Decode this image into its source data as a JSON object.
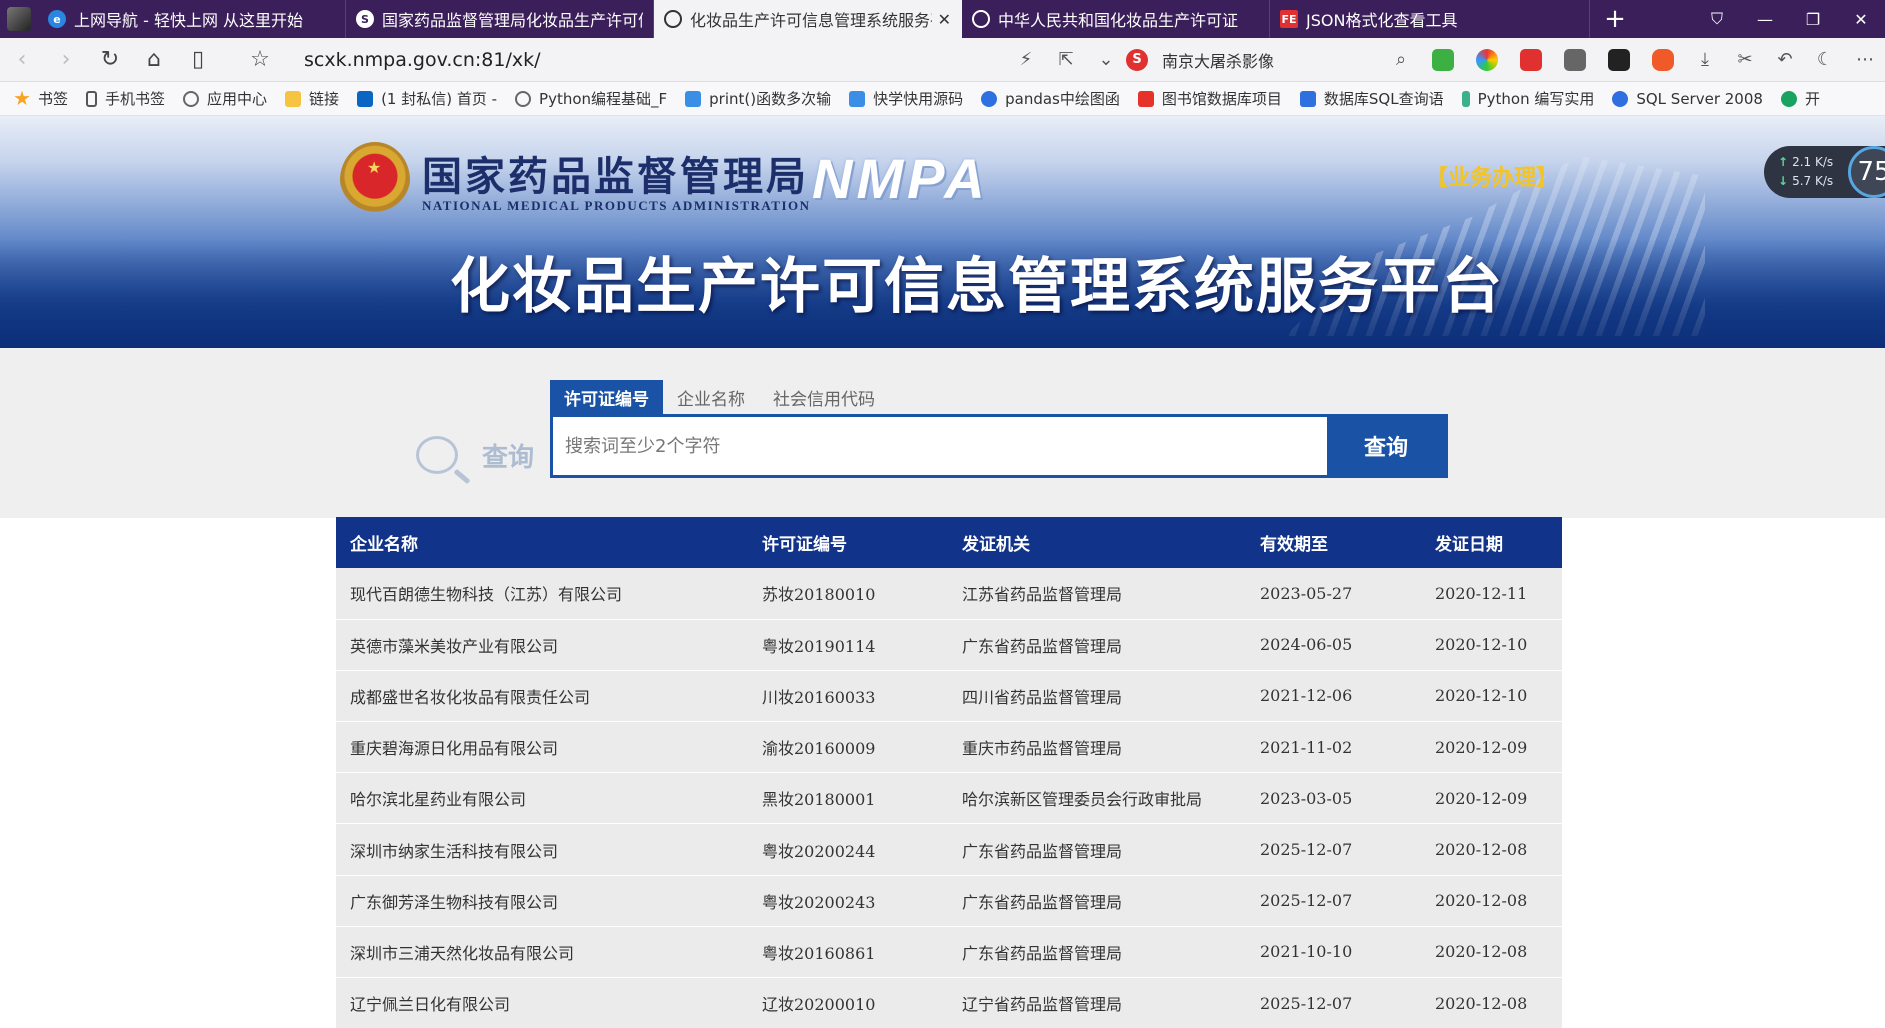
{
  "browser": {
    "tabs": [
      {
        "title": "上网导航 - 轻快上网 从这里开始",
        "icon": "ie-icon"
      },
      {
        "title": "国家药品监督管理局化妆品生产许可信",
        "icon": "s-logo-icon"
      },
      {
        "title": "化妆品生产许可信息管理系统服务平",
        "icon": "globe-icon",
        "active": true
      },
      {
        "title": "中华人民共和国化妆品生产许可证",
        "icon": "globe-icon"
      },
      {
        "title": "JSON格式化查看工具",
        "icon": "fe-icon"
      }
    ],
    "url": "scxk.nmpa.gov.cn:81/xk/",
    "search_engine_text": "南京大屠杀影像",
    "bookmarks": [
      "书签",
      "手机书签",
      "应用中心",
      "链接",
      "(1 封私信) 首页 -",
      "Python编程基础_F",
      "print()函数多次输",
      "快学快用源码",
      "pandas中绘图函",
      "图书馆数据库项目",
      "数据库SQL查询语",
      "Python 编写实用",
      "SQL Server 2008",
      "开"
    ],
    "speed": {
      "up": "2.1",
      "down": "5.7",
      "unit": "K/s",
      "percent": "75"
    }
  },
  "header": {
    "agency_cn": "国家药品监督管理局",
    "agency_en": "NATIONAL MEDICAL PRODUCTS ADMINISTRATION",
    "brand": "NMPA",
    "business_link": "【业务办理】",
    "platform_title": "化妆品生产许可信息管理系统服务平台"
  },
  "search": {
    "logo_text": "查询",
    "tabs": [
      "许可证编号",
      "企业名称",
      "社会信用代码"
    ],
    "active_tab": 0,
    "placeholder": "搜索词至少2个字符",
    "value": "",
    "button_label": "查询"
  },
  "table": {
    "columns": [
      "企业名称",
      "许可证编号",
      "发证机关",
      "有效期至",
      "发证日期"
    ],
    "rows": [
      [
        "现代百朗德生物科技（江苏）有限公司",
        "苏妆20180010",
        "江苏省药品监督管理局",
        "2023-05-27",
        "2020-12-11"
      ],
      [
        "英德市藻米美妆产业有限公司",
        "粤妆20190114",
        "广东省药品监督管理局",
        "2024-06-05",
        "2020-12-10"
      ],
      [
        "成都盛世名妆化妆品有限责任公司",
        "川妆20160033",
        "四川省药品监督管理局",
        "2021-12-06",
        "2020-12-10"
      ],
      [
        "重庆碧海源日化用品有限公司",
        "渝妆20160009",
        "重庆市药品监督管理局",
        "2021-11-02",
        "2020-12-09"
      ],
      [
        "哈尔滨北星药业有限公司",
        "黑妆20180001",
        "哈尔滨新区管理委员会行政审批局",
        "2023-03-05",
        "2020-12-09"
      ],
      [
        "深圳市纳家生活科技有限公司",
        "粤妆20200244",
        "广东省药品监督管理局",
        "2025-12-07",
        "2020-12-08"
      ],
      [
        "广东御芳泽生物科技有限公司",
        "粤妆20200243",
        "广东省药品监督管理局",
        "2025-12-07",
        "2020-12-08"
      ],
      [
        "深圳市三浦天然化妆品有限公司",
        "粤妆20160861",
        "广东省药品监督管理局",
        "2021-10-10",
        "2020-12-08"
      ],
      [
        "辽宁佩兰日化有限公司",
        "辽妆20200010",
        "辽宁省药品监督管理局",
        "2025-12-07",
        "2020-12-08"
      ]
    ]
  },
  "colors": {
    "tabstrip": "#3b1f5a",
    "accent_blue": "#1a52a6",
    "table_header": "#12338a",
    "business_gold": "#f4c425"
  }
}
